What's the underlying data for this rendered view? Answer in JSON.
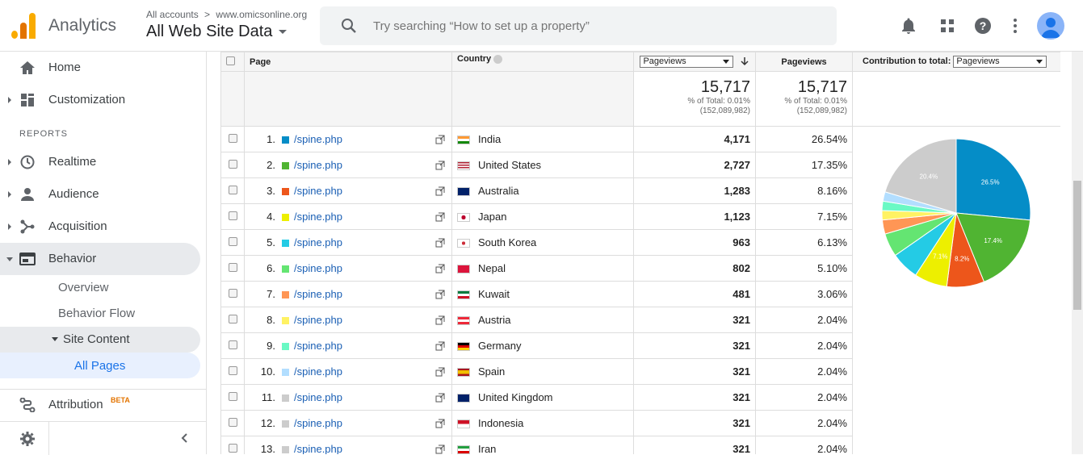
{
  "app": {
    "name": "Analytics",
    "brand_color": "#f9ab00"
  },
  "account": {
    "crumb_all": "All accounts",
    "crumb_sep": ">",
    "crumb_site": "www.omicsonline.org",
    "view": "All Web Site Data"
  },
  "search": {
    "placeholder": "Try searching “How to set up a property”"
  },
  "topbar_icons": [
    "bell-icon",
    "apps-icon",
    "help-icon",
    "more-vert-icon",
    "account-icon"
  ],
  "sidebar": {
    "home": "Home",
    "customization": "Customization",
    "reports_heading": "REPORTS",
    "realtime": "Realtime",
    "audience": "Audience",
    "acquisition": "Acquisition",
    "behavior": "Behavior",
    "overview": "Overview",
    "behavior_flow": "Behavior Flow",
    "site_content": "Site Content",
    "all_pages": "All Pages",
    "attribution": "Attribution",
    "beta": "BETA"
  },
  "table": {
    "col_page": "Page",
    "col_country": "Country",
    "metric_select": "Pageviews",
    "col_pageviews": "Pageviews",
    "contribution_label": "Contribution to total:",
    "contribution_select": "Pageviews",
    "total_value": "15,717",
    "total_pct": "% of Total: 0.01%",
    "total_of": "(152,089,982)",
    "total_value2": "15,717",
    "total_pct2": "% of Total: 0.01%",
    "total_of2": "(152,089,982)",
    "rows": [
      {
        "idx": "1.",
        "page": "/spine.php",
        "country": "India",
        "pv": "4,171",
        "share": "26.54%",
        "color": "#058dc7"
      },
      {
        "idx": "2.",
        "page": "/spine.php",
        "country": "United States",
        "pv": "2,727",
        "share": "17.35%",
        "color": "#50b432"
      },
      {
        "idx": "3.",
        "page": "/spine.php",
        "country": "Australia",
        "pv": "1,283",
        "share": "8.16%",
        "color": "#ed561b"
      },
      {
        "idx": "4.",
        "page": "/spine.php",
        "country": "Japan",
        "pv": "1,123",
        "share": "7.15%",
        "color": "#edef00"
      },
      {
        "idx": "5.",
        "page": "/spine.php",
        "country": "South Korea",
        "pv": "963",
        "share": "6.13%",
        "color": "#24cbe5"
      },
      {
        "idx": "6.",
        "page": "/spine.php",
        "country": "Nepal",
        "pv": "802",
        "share": "5.10%",
        "color": "#64e572"
      },
      {
        "idx": "7.",
        "page": "/spine.php",
        "country": "Kuwait",
        "pv": "481",
        "share": "3.06%",
        "color": "#ff9655"
      },
      {
        "idx": "8.",
        "page": "/spine.php",
        "country": "Austria",
        "pv": "321",
        "share": "2.04%",
        "color": "#fff263"
      },
      {
        "idx": "9.",
        "page": "/spine.php",
        "country": "Germany",
        "pv": "321",
        "share": "2.04%",
        "color": "#6af9c4"
      },
      {
        "idx": "10.",
        "page": "/spine.php",
        "country": "Spain",
        "pv": "321",
        "share": "2.04%",
        "color": "#b2deff"
      },
      {
        "idx": "11.",
        "page": "/spine.php",
        "country": "United Kingdom",
        "pv": "321",
        "share": "2.04%",
        "color": "#cccccc"
      },
      {
        "idx": "12.",
        "page": "/spine.php",
        "country": "Indonesia",
        "pv": "321",
        "share": "2.04%",
        "color": "#cccccc"
      },
      {
        "idx": "13.",
        "page": "/spine.php",
        "country": "Iran",
        "pv": "321",
        "share": "2.04%",
        "color": "#cccccc"
      }
    ]
  },
  "pie": {
    "labels_shown": [
      "26.5%",
      "17.4%",
      "8.2%",
      "7.1%",
      "20.4%"
    ],
    "slices": [
      {
        "value": 26.54,
        "color": "#058dc7",
        "label": "26.5%"
      },
      {
        "value": 17.35,
        "color": "#50b432",
        "label": "17.4%"
      },
      {
        "value": 8.16,
        "color": "#ed561b",
        "label": "8.2%"
      },
      {
        "value": 7.15,
        "color": "#edef00",
        "label": "7.1%"
      },
      {
        "value": 6.13,
        "color": "#24cbe5",
        "label": ""
      },
      {
        "value": 5.1,
        "color": "#64e572",
        "label": ""
      },
      {
        "value": 3.06,
        "color": "#ff9655",
        "label": ""
      },
      {
        "value": 2.04,
        "color": "#fff263",
        "label": ""
      },
      {
        "value": 2.04,
        "color": "#6af9c4",
        "label": ""
      },
      {
        "value": 2.04,
        "color": "#b2deff",
        "label": ""
      },
      {
        "value": 20.4,
        "color": "#cccccc",
        "label": "20.4%"
      }
    ]
  }
}
